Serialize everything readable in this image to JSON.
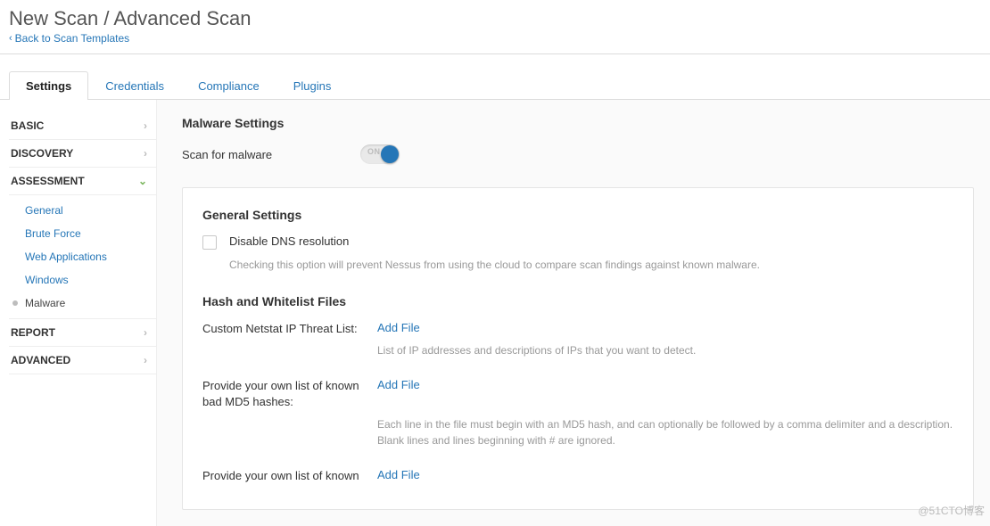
{
  "header": {
    "title": "New Scan / Advanced Scan",
    "back_label": "Back to Scan Templates"
  },
  "tabs": [
    {
      "label": "Settings",
      "active": true
    },
    {
      "label": "Credentials",
      "active": false
    },
    {
      "label": "Compliance",
      "active": false
    },
    {
      "label": "Plugins",
      "active": false
    }
  ],
  "sidebar": {
    "categories": [
      {
        "label": "BASIC",
        "expanded": false
      },
      {
        "label": "DISCOVERY",
        "expanded": false
      },
      {
        "label": "ASSESSMENT",
        "expanded": true,
        "items": [
          {
            "label": "General",
            "active": false
          },
          {
            "label": "Brute Force",
            "active": false
          },
          {
            "label": "Web Applications",
            "active": false
          },
          {
            "label": "Windows",
            "active": false
          },
          {
            "label": "Malware",
            "active": true
          }
        ]
      },
      {
        "label": "REPORT",
        "expanded": false
      },
      {
        "label": "ADVANCED",
        "expanded": false
      }
    ]
  },
  "main": {
    "malware_section_title": "Malware Settings",
    "scan_toggle_label": "Scan for malware",
    "toggle_on_text": "ON",
    "general_section_title": "General Settings",
    "dns_checkbox_label": "Disable DNS resolution",
    "dns_help": "Checking this option will prevent Nessus from using the cloud to compare scan findings against known malware.",
    "hash_section_title": "Hash and Whitelist Files",
    "rows": [
      {
        "label": "Custom Netstat IP Threat List:",
        "action": "Add File",
        "help": "List of IP addresses and descriptions of IPs that you want to detect."
      },
      {
        "label": "Provide your own list of known bad MD5 hashes:",
        "action": "Add File",
        "help": "Each line in the file must begin with an MD5 hash, and can optionally be followed by a comma delimiter and a description. Blank lines and lines beginning with # are ignored."
      },
      {
        "label": "Provide your own list of known",
        "action": "Add File",
        "help": ""
      }
    ]
  },
  "watermark": "@51CTO博客"
}
